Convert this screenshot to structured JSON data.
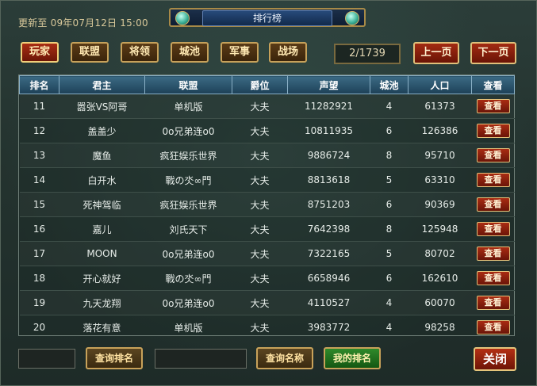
{
  "header": {
    "updated": "更新至 09年07月12日 15:00",
    "title": "排行榜"
  },
  "tabs": [
    {
      "label": "玩家",
      "active": true
    },
    {
      "label": "联盟"
    },
    {
      "label": "将领"
    },
    {
      "label": "城池"
    },
    {
      "label": "军事"
    },
    {
      "label": "战场"
    }
  ],
  "pagination": {
    "indicator": "2/1739",
    "prev_label": "上一页",
    "next_label": "下一页"
  },
  "table": {
    "headers": [
      "排名",
      "君主",
      "联盟",
      "爵位",
      "声望",
      "城池",
      "人口",
      "查看"
    ],
    "view_label": "查看",
    "rows": [
      [
        "11",
        "嚣张VS阿哥",
        "单机版",
        "大夫",
        "11282921",
        "4",
        "61373"
      ],
      [
        "12",
        "盖盖少",
        "0o兄弟连o0",
        "大夫",
        "10811935",
        "6",
        "126386"
      ],
      [
        "13",
        "魔鱼",
        "疯狂娱乐世界",
        "大夫",
        "9886724",
        "8",
        "95710"
      ],
      [
        "14",
        "白开水",
        "戰の氼∞門",
        "大夫",
        "8813618",
        "5",
        "63310"
      ],
      [
        "15",
        "死神驾临",
        "疯狂娱乐世界",
        "大夫",
        "8751203",
        "6",
        "90369"
      ],
      [
        "16",
        "嘉儿",
        "刘氏天下",
        "大夫",
        "7642398",
        "8",
        "125948"
      ],
      [
        "17",
        "MOON",
        "0o兄弟连o0",
        "大夫",
        "7322165",
        "5",
        "80702"
      ],
      [
        "18",
        "开心就好",
        "戰の氼∞門",
        "大夫",
        "6658946",
        "6",
        "162610"
      ],
      [
        "19",
        "九天龙翔",
        "0o兄弟连o0",
        "大夫",
        "4110527",
        "4",
        "60070"
      ],
      [
        "20",
        "落花有意",
        "单机版",
        "大夫",
        "3983772",
        "4",
        "98258"
      ]
    ]
  },
  "footer": {
    "rank_search_label": "查询排名",
    "name_search_label": "查询名称",
    "my_rank_label": "我的排名",
    "close_label": "关闭"
  }
}
